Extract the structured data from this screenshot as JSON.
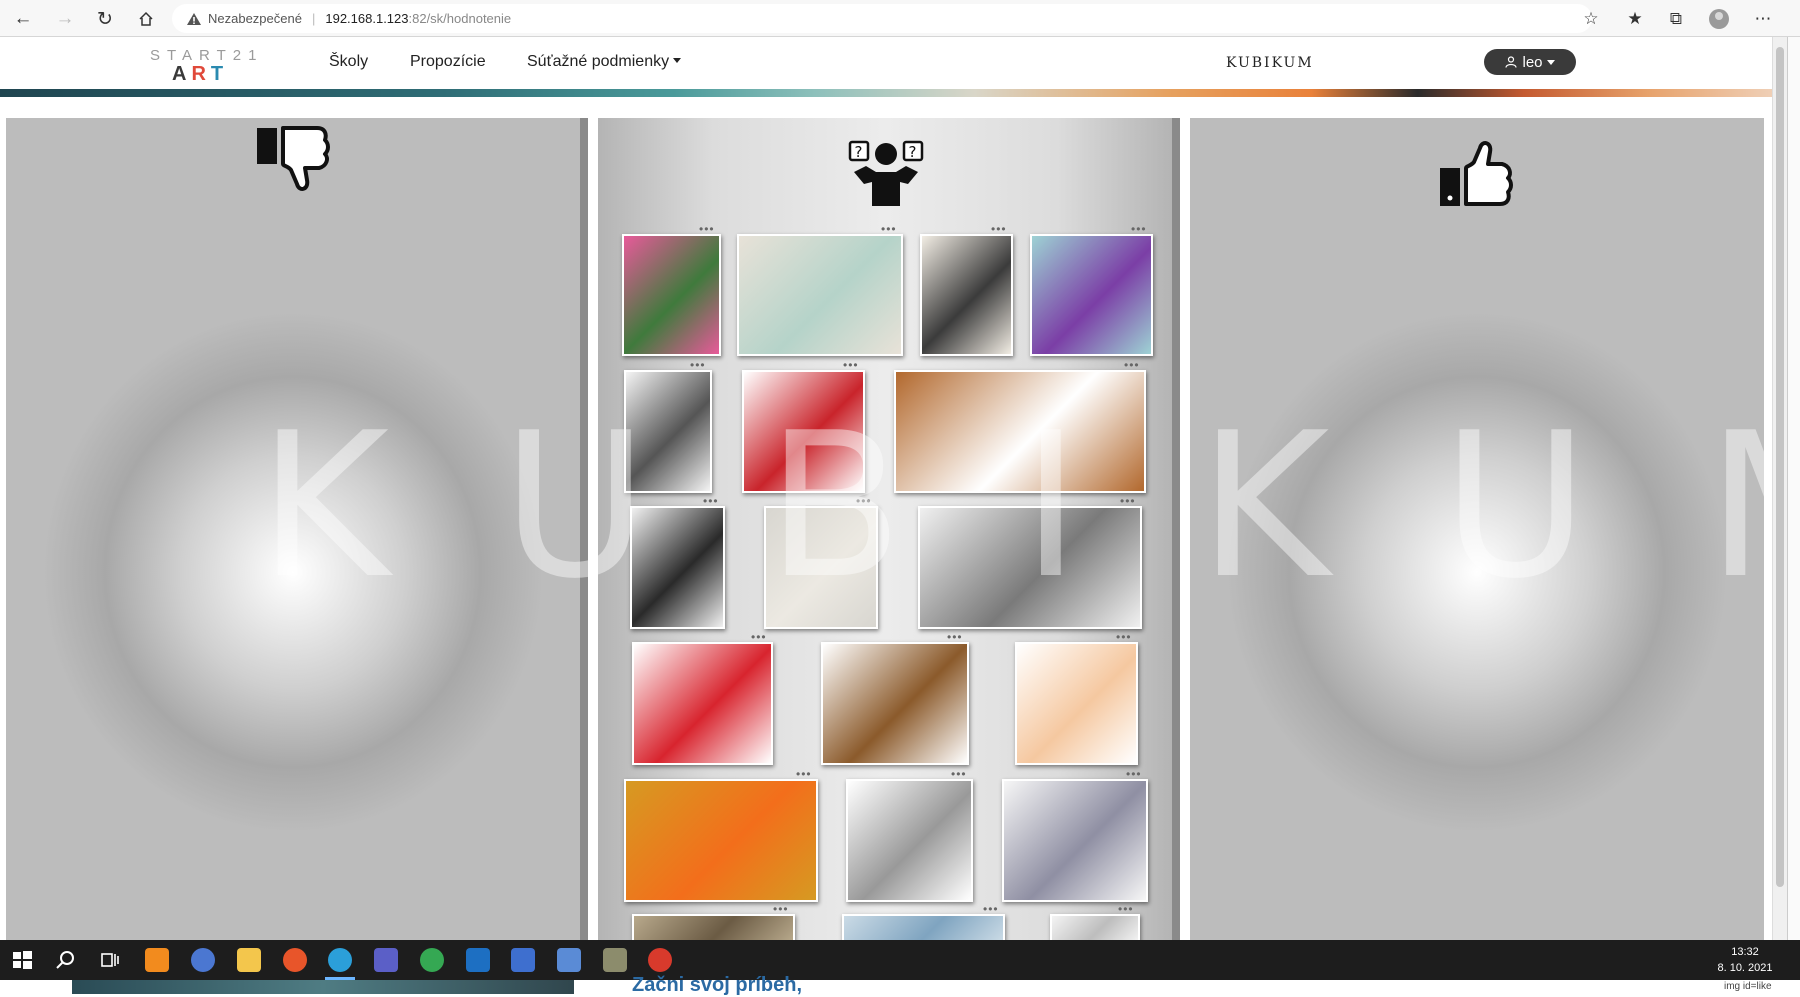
{
  "browser": {
    "warning_label": "Nezabezpečené",
    "url_host": "192.168.1.123",
    "url_path": ":82/sk/hodnotenie"
  },
  "site": {
    "logo_top": "START21",
    "logo_bottom": [
      "A",
      "R",
      "T"
    ],
    "menu": [
      "Školy",
      "Propozície",
      "Súťažné podmienky"
    ],
    "brand": "KUBIKUM",
    "user": "leo"
  },
  "watermark": "KUBIKUM",
  "columns": {
    "left_icon": "thumbs-down-icon",
    "middle_icon": "question-person-icon",
    "right_icon": "thumbs-up-icon"
  },
  "artworks": [
    {
      "name": "artwork-cherry-blossom-path",
      "colors": [
        "#e85a9a",
        "#3f7a3c"
      ]
    },
    {
      "name": "artwork-caricature-shining",
      "colors": [
        "#e8e2d8",
        "#b5d3c9"
      ]
    },
    {
      "name": "artwork-caricature-bean",
      "colors": [
        "#f2ede4",
        "#3b3b3b"
      ]
    },
    {
      "name": "artwork-leela-futurama",
      "colors": [
        "#9ed2d4",
        "#7b3ea6"
      ]
    },
    {
      "name": "artwork-sketch-couple",
      "colors": [
        "#f4f4f4",
        "#555555"
      ]
    },
    {
      "name": "artwork-bear-glasses",
      "colors": [
        "#ffffff",
        "#c9242b"
      ]
    },
    {
      "name": "artwork-child-drawing-house",
      "colors": [
        "#b2682d",
        "#ffffff"
      ]
    },
    {
      "name": "artwork-charcoal-figure",
      "colors": [
        "#f1f1f1",
        "#2a2a2a"
      ]
    },
    {
      "name": "artwork-skull-sketch",
      "colors": [
        "#d8d6d0",
        "#ece9e2"
      ]
    },
    {
      "name": "artwork-hand-drawing-hand",
      "colors": [
        "#f0f0f0",
        "#7a7a7a"
      ]
    },
    {
      "name": "artwork-strawberries",
      "colors": [
        "#ffffff",
        "#d8242e"
      ]
    },
    {
      "name": "artwork-cartoon-monkey",
      "colors": [
        "#ffffff",
        "#8b5a2b"
      ]
    },
    {
      "name": "artwork-sad-boy",
      "colors": [
        "#ffffff",
        "#f5c8a0"
      ]
    },
    {
      "name": "artwork-fry-futurama",
      "colors": [
        "#d69a22",
        "#f36e1b"
      ]
    },
    {
      "name": "artwork-bender-sketch",
      "colors": [
        "#ffffff",
        "#999999"
      ]
    },
    {
      "name": "artwork-tom-and-jerry",
      "colors": [
        "#f6f6f6",
        "#8f8fa3"
      ]
    },
    {
      "name": "artwork-partial-1",
      "colors": [
        "#b8a98c",
        "#6b5b44"
      ]
    },
    {
      "name": "artwork-partial-2",
      "colors": [
        "#cbdbe6",
        "#7fa4c0"
      ]
    },
    {
      "name": "artwork-partial-3",
      "colors": [
        "#f4f4f4",
        "#bdbdbd"
      ]
    }
  ],
  "under": {
    "story_text": "Začni svoj príbeh,",
    "img_label": "img id=like"
  },
  "taskbar": {
    "time": "13:32",
    "date": "8. 10. 2021"
  }
}
